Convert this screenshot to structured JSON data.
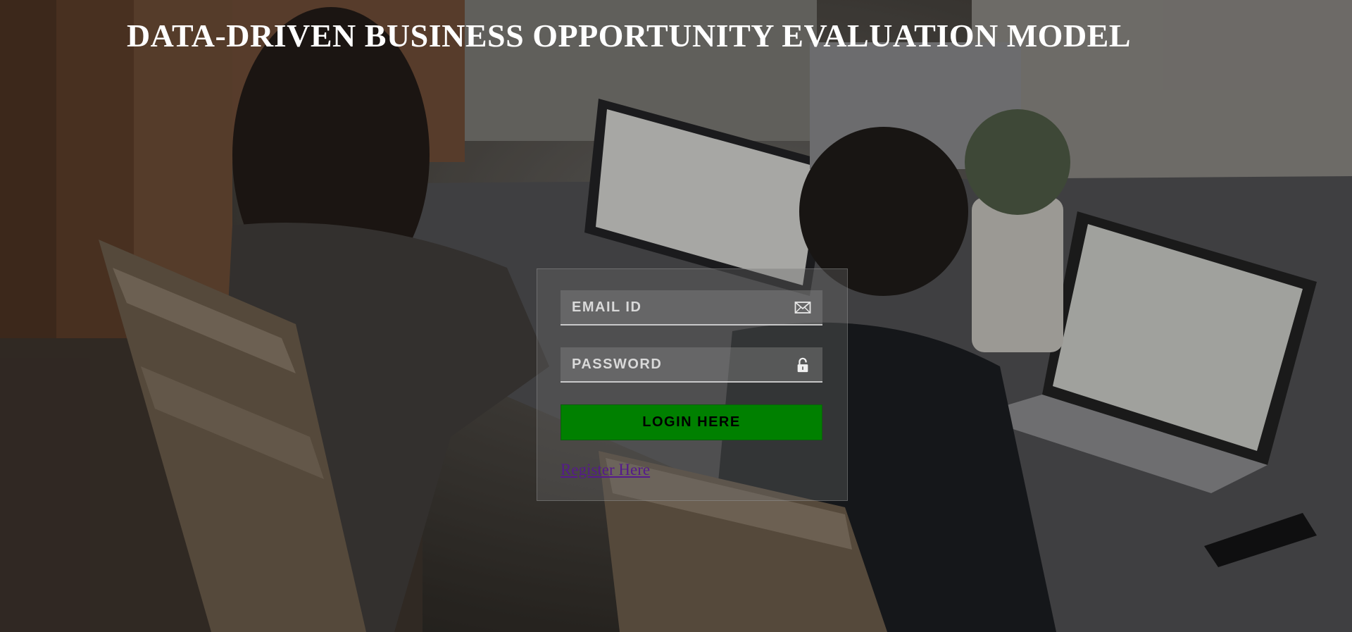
{
  "page": {
    "title": "DATA-DRIVEN BUSINESS OPPORTUNITY EVALUATION MODEL"
  },
  "login": {
    "email_placeholder": "EMAIL ID",
    "email_value": "",
    "password_placeholder": "PASSWORD",
    "password_value": "",
    "submit_label": "LOGIN HERE",
    "register_label": "Register Here"
  },
  "icons": {
    "email": "envelope-icon",
    "password": "padlock-icon"
  },
  "colors": {
    "title": "#ffffff",
    "button": "#008000",
    "button_text": "#000000",
    "link": "#551a8b"
  }
}
